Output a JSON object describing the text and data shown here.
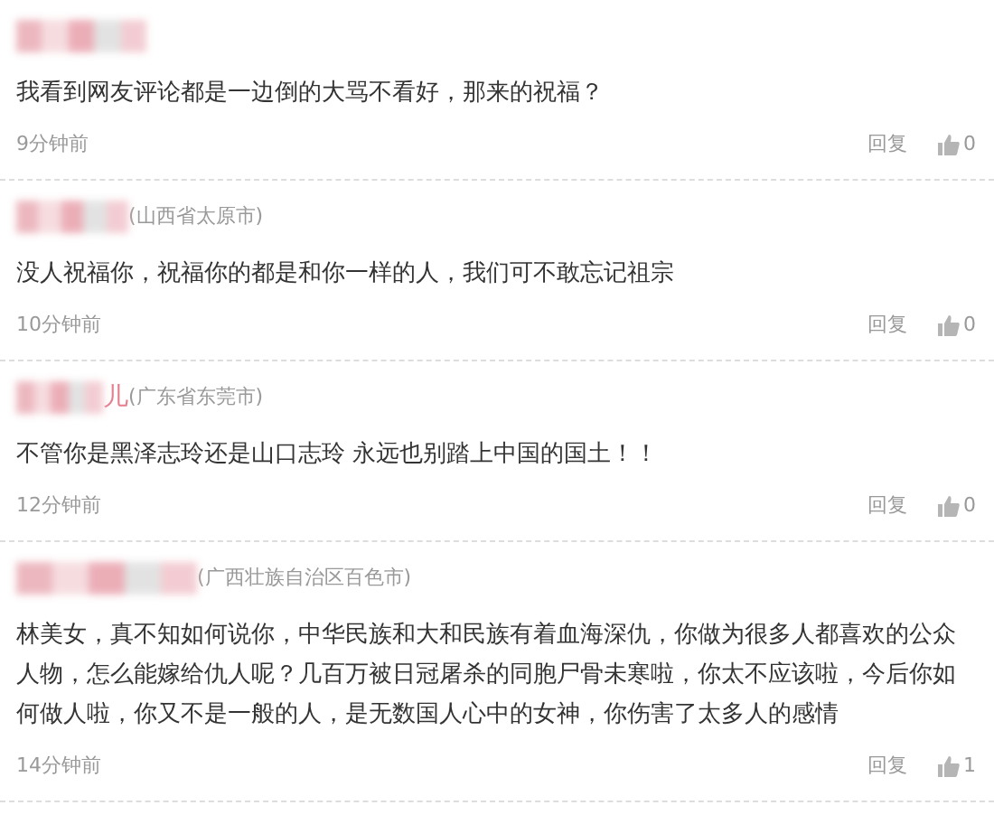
{
  "comments": [
    {
      "text": "我看到网友评论都是一边倒的大骂不看好，那来的祝福？",
      "time": "9分钟前",
      "reply": "回复",
      "likes": "0"
    },
    {
      "location": "(山西省太原市)",
      "text": "没人祝福你，祝福你的都是和你一样的人，我们可不敢忘记祖宗",
      "time": "10分钟前",
      "reply": "回复",
      "likes": "0"
    },
    {
      "name_tail": "儿",
      "location": "(广东省东莞市)",
      "text": "不管你是黑泽志玲还是山口志玲 永远也别踏上中国的国土！！",
      "time": "12分钟前",
      "reply": "回复",
      "likes": "0"
    },
    {
      "location": "(广西壮族自治区百色市)",
      "text": "林美女，真不知如何说你，中华民族和大和民族有着血海深仇，你做为很多人都喜欢的公众人物，怎么能嫁给仇人呢？几百万被日冠屠杀的同胞尸骨未寒啦，你太不应该啦，今后你如何做人啦，你又不是一般的人，是无数国人心中的女神，你伤害了太多人的感情",
      "time": "14分钟前",
      "reply": "回复",
      "likes": "1"
    }
  ]
}
